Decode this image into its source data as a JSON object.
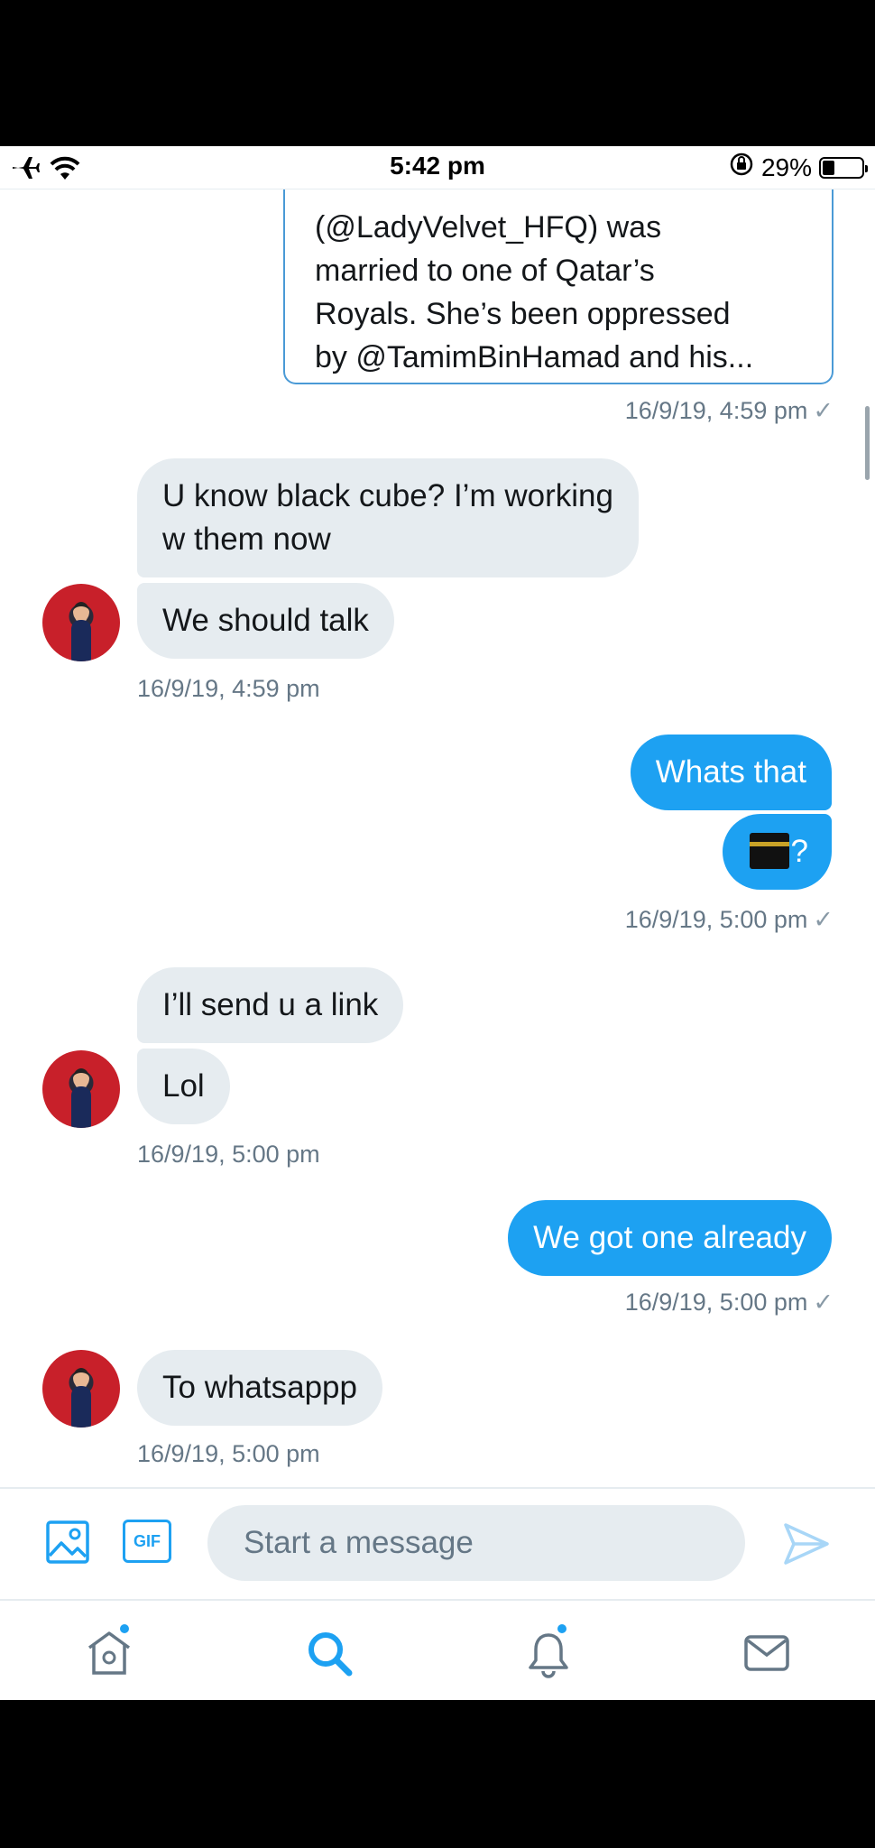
{
  "status_bar": {
    "time": "5:42 pm",
    "battery_percent": "29%",
    "battery_level": 0.29,
    "icons": [
      "airplane-icon",
      "wifi-icon",
      "orientation-lock-icon",
      "battery-icon"
    ]
  },
  "quoted_tweet": {
    "lines": [
      "(@LadyVelvet_HFQ) was",
      "married to one of Qatar’s",
      "Royals. She’s been oppressed",
      "by @TamimBinHamad and his..."
    ],
    "timestamp": "16/9/19, 4:59 pm"
  },
  "messages": [
    {
      "id": "m1",
      "direction": "in",
      "lines": [
        "U know black cube? I’m working",
        "w them now"
      ]
    },
    {
      "id": "m2",
      "direction": "in",
      "text": "We should talk"
    },
    {
      "id": "ts1",
      "timestamp": "16/9/19, 4:59 pm"
    },
    {
      "id": "m3",
      "direction": "out",
      "text": "Whats that"
    },
    {
      "id": "m4",
      "direction": "out",
      "text": "?",
      "emoji": "kaaba"
    },
    {
      "id": "ts2",
      "timestamp": "16/9/19, 5:00 pm"
    },
    {
      "id": "m5",
      "direction": "in",
      "text": "I’ll send u a link"
    },
    {
      "id": "m6",
      "direction": "in",
      "text": "Lol"
    },
    {
      "id": "ts3",
      "timestamp": "16/9/19, 5:00 pm"
    },
    {
      "id": "m7",
      "direction": "out",
      "text": "We got one already"
    },
    {
      "id": "ts4",
      "timestamp": "16/9/19, 5:00 pm"
    },
    {
      "id": "m8",
      "direction": "in",
      "text": "To whatsappp"
    },
    {
      "id": "ts5",
      "timestamp": "16/9/19, 5:00 pm"
    }
  ],
  "composer": {
    "placeholder": "Start a message",
    "gif_label": "GIF"
  },
  "tabbar": {
    "tabs": [
      "home",
      "search",
      "notifications",
      "messages"
    ]
  },
  "colors": {
    "accent": "#1da1f2",
    "bubble_in": "#e6ecf0",
    "text_secondary": "#657786"
  }
}
